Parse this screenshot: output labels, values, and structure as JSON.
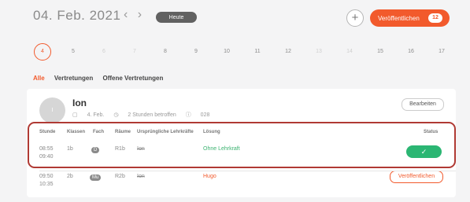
{
  "header": {
    "date": "04. Feb. 2021",
    "prev_arrow": "‹",
    "next_arrow": "›",
    "today_label": "Heute",
    "plus_label": "+",
    "publish_label": "Veröffentlichen",
    "publish_count": "12"
  },
  "days": [
    "4",
    "5",
    "6",
    "7",
    "8",
    "9",
    "10",
    "11",
    "12",
    "13",
    "14",
    "15",
    "16",
    "17"
  ],
  "filters": [
    "Alle",
    "Vertretungen",
    "Offene Vertretungen"
  ],
  "card": {
    "avatar_initial": "I",
    "teacher_name": "Ion",
    "date_meta": "4. Feb.",
    "hours_meta": "2 Stunden betroffen",
    "id_meta": "028",
    "edit_label": "Bearbeiten",
    "columns": [
      "Stunde",
      "Klassen",
      "Fach",
      "Räume",
      "Ursprüngliche Lehrkräfte",
      "Lösung",
      "Status"
    ],
    "rows": [
      {
        "time_start": "08:55",
        "time_end": "09:40",
        "class": "1b",
        "subject": "D",
        "room": "R1b",
        "teacher": "Ion",
        "solution": "Ohne Lehrkraft",
        "status_icon": "✓"
      },
      {
        "time_start": "09:50",
        "time_end": "10:35",
        "class": "2b",
        "subject": "Mu",
        "room": "R2b",
        "teacher": "Ion",
        "solution": "Hugo",
        "action_label": "Veröffentlichen"
      }
    ]
  },
  "colors": {
    "accent": "#f25a2c",
    "success": "#2bb673",
    "highlight": "#b03a34"
  }
}
